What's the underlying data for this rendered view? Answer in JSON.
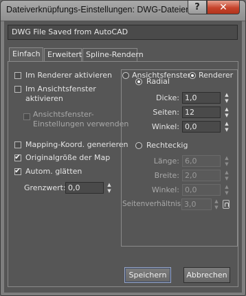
{
  "window": {
    "title": "Dateiverknüpfungs-Einstellungen: DWG-Dateien",
    "help_label": "?",
    "close_label": "✕"
  },
  "file_label": "DWG File Saved from AutoCAD",
  "tabs": [
    {
      "label": "Einfach",
      "active": true
    },
    {
      "label": "Erweitert",
      "active": false
    },
    {
      "label": "Spline-Rendern",
      "active": false
    }
  ],
  "left": {
    "renderer": {
      "label": "Im Renderer aktivieren",
      "checked": false
    },
    "viewport": {
      "label_line1": "Im Ansichtsfenster",
      "label_line2": "aktivieren",
      "checked": false
    },
    "viewport_settings": {
      "label_line1": "Ansichtsfenster-",
      "label_line2": "Einstellungen verwenden",
      "checked": false,
      "disabled": true
    },
    "mapping": {
      "label": "Mapping-Koord. generieren",
      "checked": false
    },
    "original_size": {
      "label": "Originalgröße der Map",
      "checked": true
    },
    "autosmooth": {
      "label": "Autom. glätten",
      "checked": true
    },
    "threshold": {
      "label": "Grenzwert:",
      "value": "0,0"
    }
  },
  "right": {
    "viewport_radio": {
      "label": "Ansichtsfenster",
      "checked": false
    },
    "renderer_radio": {
      "label": "Renderer",
      "checked": true
    },
    "radial": {
      "label": "Radial",
      "checked": true,
      "thickness": {
        "label": "Dicke:",
        "value": "1,0"
      },
      "sides": {
        "label": "Seiten:",
        "value": "12"
      },
      "angle": {
        "label": "Winkel:",
        "value": "0,0"
      }
    },
    "rectangular": {
      "label": "Rechteckig",
      "checked": false,
      "length": {
        "label": "Länge:",
        "value": "6,0"
      },
      "width": {
        "label": "Breite:",
        "value": "2,0"
      },
      "angle": {
        "label": "Winkel:",
        "value": "0,0"
      },
      "aspect": {
        "label": "Seitenverhältnis:",
        "value": "3,0"
      }
    }
  },
  "buttons": {
    "save": "Speichern",
    "cancel": "Abbrechen"
  },
  "icons": {
    "spinner_up": "▲",
    "spinner_down": "▼"
  }
}
